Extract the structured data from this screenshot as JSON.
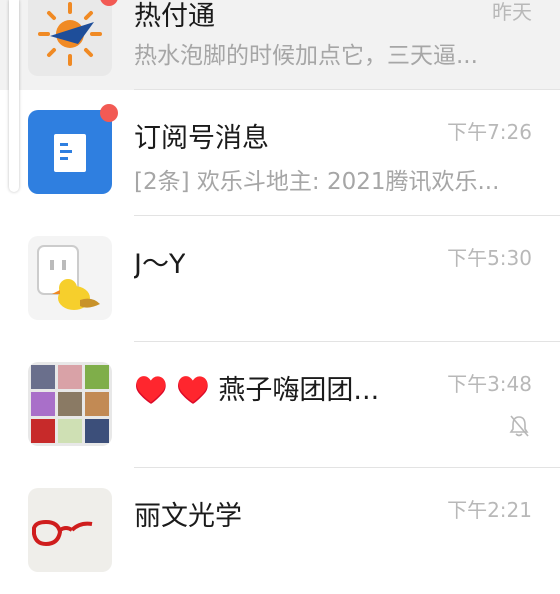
{
  "chats": [
    {
      "name": "热付通",
      "preview": "热水泡脚的时候加点它，三天逼...",
      "time": "昨天",
      "avatar_icon": "sun-plane-logo-icon"
    },
    {
      "name": "订阅号消息",
      "preview": "[2条] 欢乐斗地主: 2021腾讯欢乐...",
      "time": "下午7:26",
      "avatar_icon": "document-icon"
    },
    {
      "name": "J～Y",
      "preview": "",
      "time": "下午5:30",
      "avatar_icon": "duck-sticker-icon"
    },
    {
      "name": "♥️ ♥️ 燕子嗨团团...",
      "preview": "",
      "time": "下午3:48",
      "avatar_icon": "group-photo-grid-icon",
      "muted": true
    },
    {
      "name": "丽文光学",
      "preview": "",
      "time": "下午2:21",
      "avatar_icon": "glasses-icon"
    }
  ],
  "colors": {
    "badge": "#f25a54",
    "subscription_blue": "#2f7fe0",
    "heart": "#e0131f",
    "pinned_bg": "#f2f2f2"
  }
}
